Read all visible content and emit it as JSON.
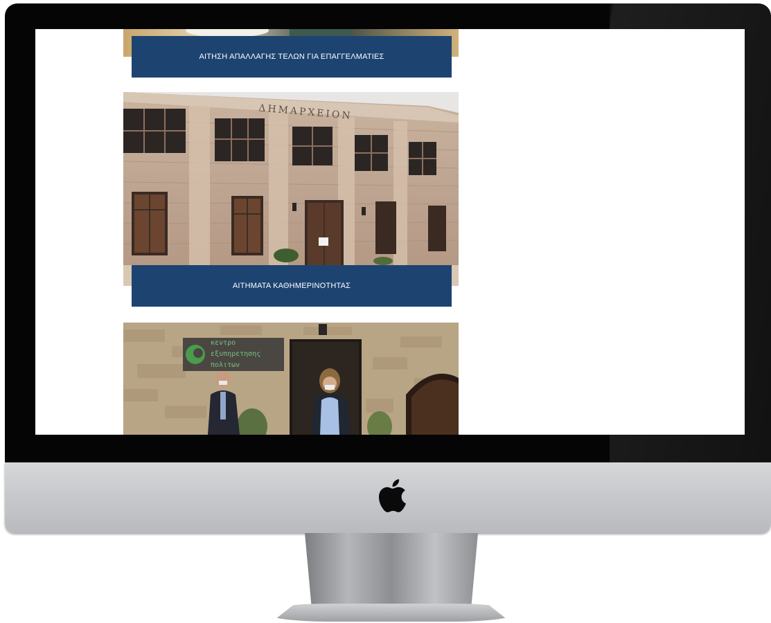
{
  "device": {
    "type": "iMac mockup",
    "logo": "apple-icon"
  },
  "page": {
    "background": "#ffffff",
    "cards": [
      {
        "label": "ΑΙΤΗΣΗ ΑΠΑΛΛΑΓΗΣ ΤΕΛΩΝ ΓΙΑ ΕΠΑΓΓΕΛΜΑΤΙΕΣ",
        "image": "partial-photo-top"
      },
      {
        "label": "ΑΙΤΗΜΑΤΑ ΚΑΘΗΜΕΡΙΝΟΤΗΤΑΣ",
        "image": "town-hall-building-photo",
        "image_text": "ΔΗΜΑΡΧΕΙΟΝ"
      },
      {
        "label": "",
        "image": "citizen-service-center-photo",
        "image_text": "κεντρο εξυπηρετησης πολιτων"
      }
    ]
  },
  "colors": {
    "label_bg": "#1d4471",
    "label_text": "#ffffff",
    "bezel": "#050505",
    "chin": "#c8c9cc"
  }
}
